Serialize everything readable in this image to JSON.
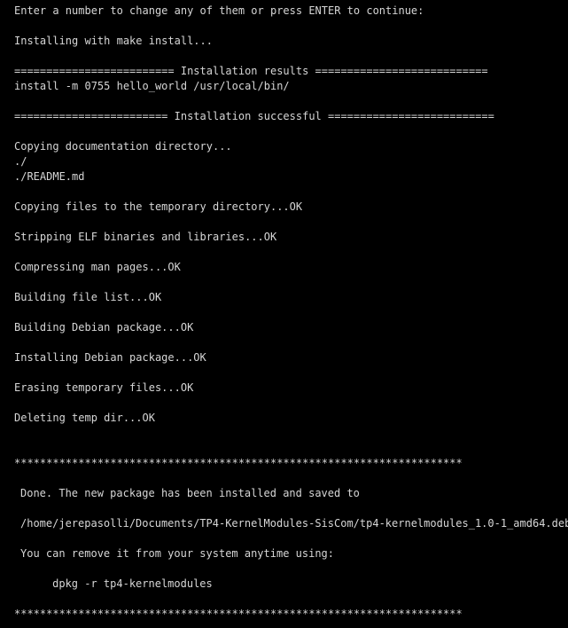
{
  "terminal": {
    "background_color": "#000000",
    "text_color": "#d6d6d6",
    "lines": [
      "Enter a number to change any of them or press ENTER to continue:",
      "",
      "Installing with make install...",
      "",
      "========================= Installation results ===========================",
      "install -m 0755 hello_world /usr/local/bin/",
      "",
      "======================== Installation successful ==========================",
      "",
      "Copying documentation directory...",
      "./",
      "./README.md",
      "",
      "Copying files to the temporary directory...OK",
      "",
      "Stripping ELF binaries and libraries...OK",
      "",
      "Compressing man pages...OK",
      "",
      "Building file list...OK",
      "",
      "Building Debian package...OK",
      "",
      "Installing Debian package...OK",
      "",
      "Erasing temporary files...OK",
      "",
      "Deleting temp dir...OK",
      "",
      "",
      "**********************************************************************",
      "",
      "Done. The new package has been installed and saved to",
      "",
      "/home/jerepasolli/Documents/TP4-KernelModules-SisCom/tp4-kernelmodules_1.0-1_amd64.deb",
      "",
      "You can remove it from your system anytime using:",
      "",
      "     dpkg -r tp4-kernelmodules",
      "",
      "**********************************************************************"
    ]
  }
}
